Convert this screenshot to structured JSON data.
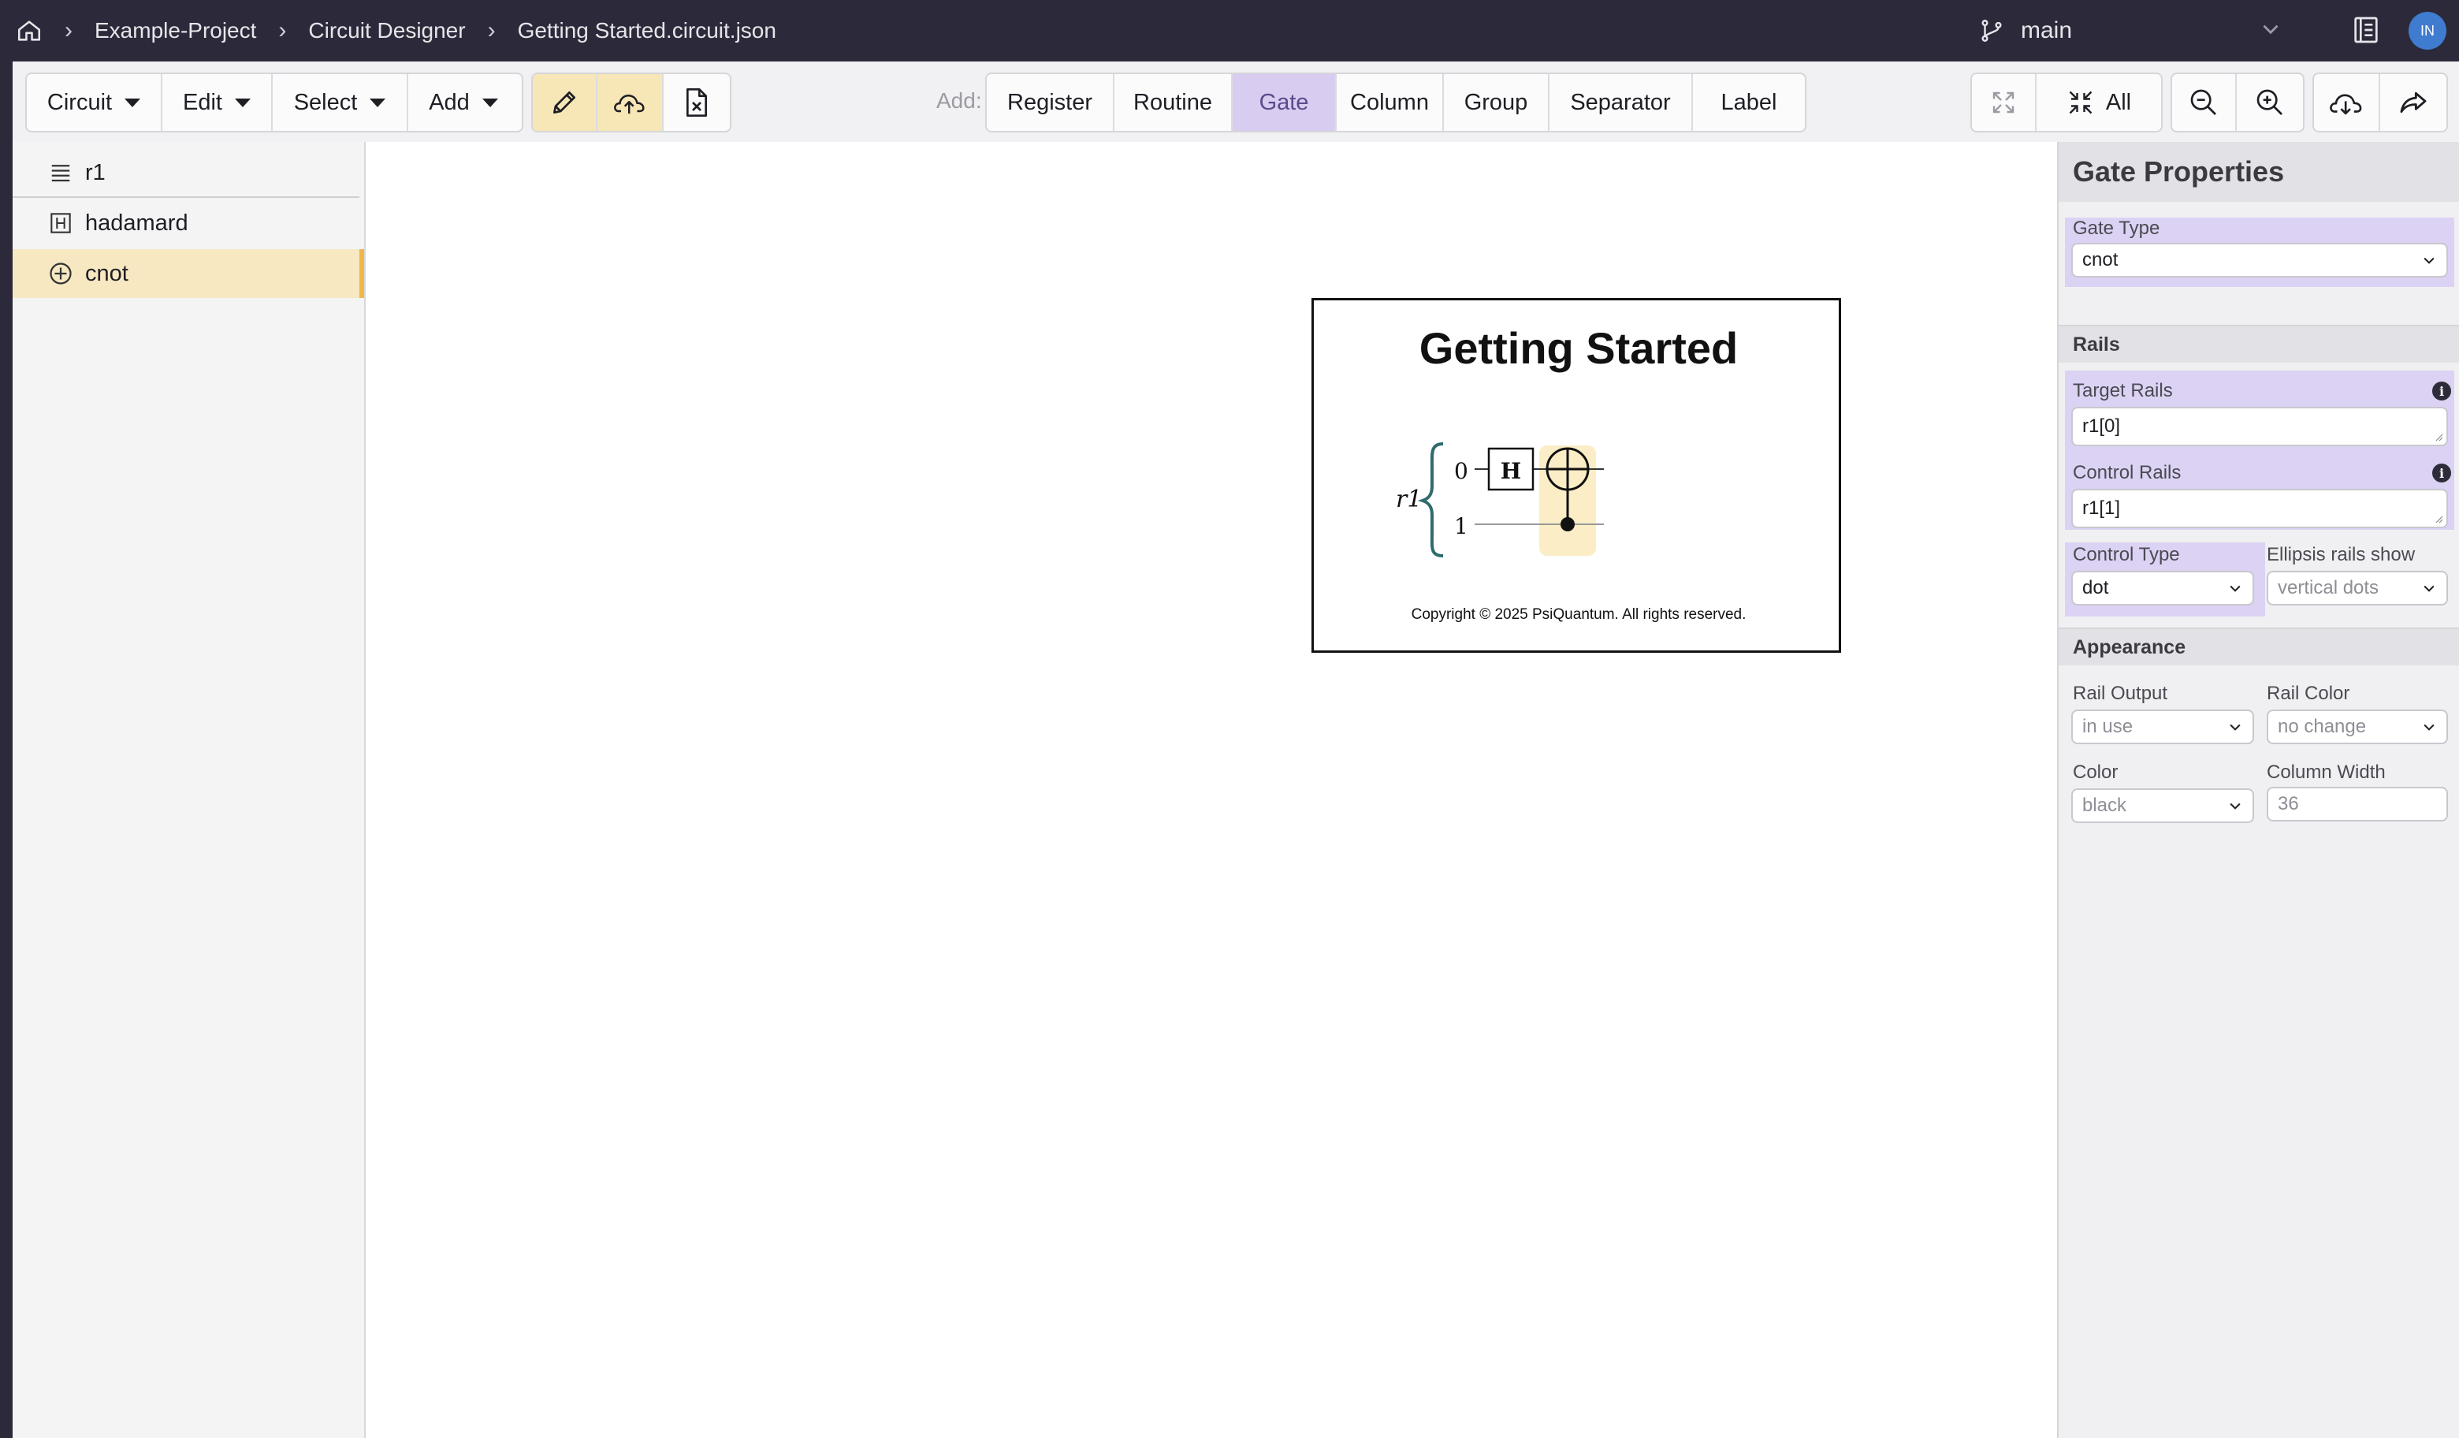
{
  "breadcrumb": {
    "items": [
      "Example-Project",
      "Circuit Designer",
      "Getting Started.circuit.json"
    ]
  },
  "branch": {
    "name": "main"
  },
  "user": {
    "initials": "IN"
  },
  "toolbar": {
    "menus": [
      "Circuit",
      "Edit",
      "Select",
      "Add"
    ],
    "add_label": "Add:",
    "add_items": [
      "Register",
      "Routine",
      "Gate",
      "Column",
      "Group",
      "Separator",
      "Label"
    ],
    "active_add_item": "Gate",
    "fit_all_label": "All"
  },
  "sidebar": {
    "items": [
      {
        "label": "r1",
        "icon": "register-icon"
      },
      {
        "label": "hadamard",
        "icon": "h-box-icon"
      },
      {
        "label": "cnot",
        "icon": "circled-plus-icon",
        "selected": true
      }
    ]
  },
  "document": {
    "title": "Getting Started",
    "register_label": "r1",
    "qubit_indices": [
      "0",
      "1"
    ],
    "gate_label": "H",
    "copyright": "Copyright © 2025 PsiQuantum. All rights reserved."
  },
  "properties": {
    "title": "Gate Properties",
    "gate_type": {
      "label": "Gate Type",
      "value": "cnot"
    },
    "rails_section": "Rails",
    "target_rails": {
      "label": "Target Rails",
      "value": "r1[0]"
    },
    "control_rails": {
      "label": "Control Rails",
      "value": "r1[1]"
    },
    "control_type": {
      "label": "Control Type",
      "value": "dot"
    },
    "ellipsis_rails": {
      "label": "Ellipsis rails show",
      "value": "vertical dots"
    },
    "appearance_section": "Appearance",
    "rail_output": {
      "label": "Rail Output",
      "value": "in use"
    },
    "rail_color": {
      "label": "Rail Color",
      "value": "no change"
    },
    "color": {
      "label": "Color",
      "value": "black"
    },
    "column_width": {
      "label": "Column Width",
      "placeholder": "36"
    }
  },
  "colors": {
    "topbar": "#2c2a3a",
    "highlight": "#dcd2f3",
    "selection": "#f7e8c2",
    "accent": "#f0b64a"
  }
}
